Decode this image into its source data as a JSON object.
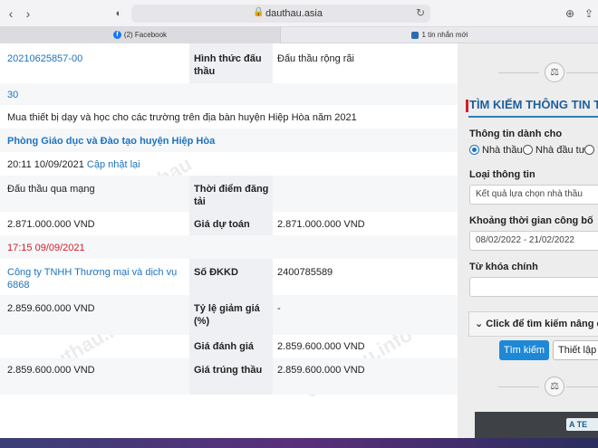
{
  "browser": {
    "url": "dauthau.asia",
    "tabs": [
      {
        "label": "(2) Facebook"
      },
      {
        "label": "1 tin nhắn mới"
      }
    ]
  },
  "detail": {
    "code": "20210625857-00",
    "method_label": "Hình thức đấu thầu",
    "method_value": "Đấu thầu rộng rãi",
    "count": "30",
    "description": "Mua thiết bị dạy và học cho các trường trên địa bàn huyện Hiệp Hòa năm 2021",
    "agency": "Phòng Giáo dục và Đào tạo huyện Hiệp Hòa",
    "time": "20:11 10/09/2021",
    "update_link": "Cập nhật lại",
    "mode": "Đấu thầu qua mạng",
    "post_time_label": "Thời điểm đăng tải",
    "price": "2.871.000.000 VND",
    "estimate_label": "Giá dự toán",
    "estimate_value": "2.871.000.000 VND",
    "deadline": "17:15 09/09/2021",
    "company": "Công ty TNHH Thương mại và dịch vụ 6868",
    "dkkd_label": "Số ĐKKD",
    "dkkd_value": "2400785589",
    "bid_price": "2.859.600.000 VND",
    "discount_label": "Tỷ lệ giảm giá (%)",
    "discount_value": "-",
    "eval_label": "Giá đánh giá",
    "eval_value": "2.859.600.000 VND",
    "win_price": "2.859.600.000 VND",
    "win_label": "Giá trúng thầu",
    "win_value": "2.859.600.000 VND"
  },
  "sidebar": {
    "title": "TÌM KIẾM THÔNG TIN TH",
    "for_label": "Thông tin dành cho",
    "radios": [
      {
        "label": "Nhà thầu",
        "checked": true
      },
      {
        "label": "Nhà đầu tư",
        "checked": false
      }
    ],
    "type_label": "Loại thông tin",
    "type_value": "Kết quả lựa chọn nhà thầu",
    "period_label": "Khoảng thời gian công bố",
    "period_value": "08/02/2022 - 21/02/2022",
    "keyword_label": "Từ khóa chính",
    "keyword_value": "",
    "advanced_label": "Click để tìm kiếm nâng ca",
    "search_button": "Tìm kiếm",
    "setup_button": "Thiết lập l",
    "ad_logo": "A TE"
  }
}
